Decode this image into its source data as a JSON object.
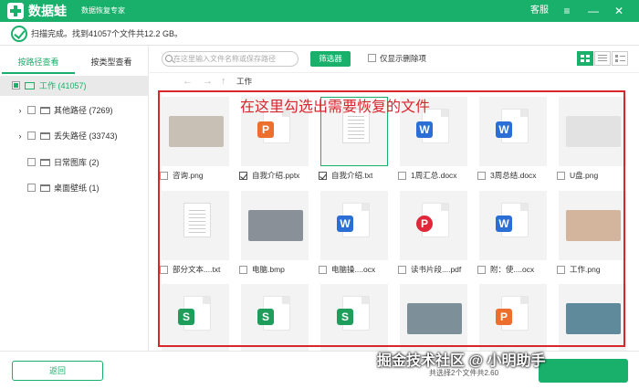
{
  "app": {
    "name": "数据蛙",
    "subtitle": "数据恢复专家",
    "service": "客服"
  },
  "window": {
    "menu_icon": "menu-icon",
    "minimize_icon": "minimize-icon",
    "close_icon": "close-icon"
  },
  "status": {
    "text": "扫描完成。找到41057个文件共12.2 GB。"
  },
  "sidebar": {
    "tabs": [
      {
        "label": "按路径查看",
        "active": true
      },
      {
        "label": "按类型查看",
        "active": false
      }
    ],
    "tree": [
      {
        "label": "工作 (41057)",
        "expandable": false,
        "selected": true,
        "check": "partial",
        "icon": "drive-icon"
      },
      {
        "label": "其他路径 (7269)",
        "expandable": true,
        "selected": false,
        "check": "none",
        "icon": "folder-icon"
      },
      {
        "label": "丢失路径 (33743)",
        "expandable": true,
        "selected": false,
        "check": "none",
        "icon": "folder-icon"
      },
      {
        "label": "日常图库 (2)",
        "expandable": false,
        "selected": false,
        "check": "none",
        "icon": "folder-icon"
      },
      {
        "label": "桌面壁纸 (1)",
        "expandable": false,
        "selected": false,
        "check": "none",
        "icon": "folder-icon"
      }
    ]
  },
  "toolbar": {
    "search_placeholder": "在这里输入文件名称或保存路径",
    "filter_label": "筛选器",
    "deleted_only_label": "仅显示删除项",
    "views": [
      "grid-view-icon",
      "list-view-icon",
      "detail-view-icon"
    ]
  },
  "path": {
    "current": "工作"
  },
  "annotation": {
    "text": "在这里勾选出需要恢复的文件"
  },
  "files": [
    {
      "name": "咨询.png",
      "type": "image",
      "checked": false,
      "color": "#c9c0b5"
    },
    {
      "name": "自我介绍.pptx",
      "type": "ppt",
      "checked": true
    },
    {
      "name": "自我介绍.txt",
      "type": "txt",
      "checked": true,
      "highlight": true
    },
    {
      "name": "1周汇总.docx",
      "type": "word",
      "checked": false
    },
    {
      "name": "3周总结.docx",
      "type": "word",
      "checked": false
    },
    {
      "name": "U盘.png",
      "type": "image",
      "checked": false,
      "color": "#e2e2e2"
    },
    {
      "name": "部分文本....txt",
      "type": "txt",
      "checked": false
    },
    {
      "name": "电脑.bmp",
      "type": "image",
      "checked": false,
      "color": "#8a9097"
    },
    {
      "name": "电脑操....ocx",
      "type": "word",
      "checked": false
    },
    {
      "name": "读书片段....pdf",
      "type": "pdf",
      "checked": false
    },
    {
      "name": "附：使....ocx",
      "type": "word",
      "checked": false
    },
    {
      "name": "工作.png",
      "type": "image",
      "checked": false,
      "color": "#d3b49c"
    },
    {
      "name": "",
      "type": "sheet",
      "checked": false
    },
    {
      "name": "",
      "type": "sheet",
      "checked": false
    },
    {
      "name": "",
      "type": "sheet",
      "checked": false
    },
    {
      "name": "",
      "type": "image",
      "checked": false,
      "color": "#7d8f99"
    },
    {
      "name": "",
      "type": "ppt",
      "checked": false
    },
    {
      "name": "",
      "type": "image",
      "checked": false,
      "color": "#5f8a9c"
    }
  ],
  "bottom": {
    "back_label": "返回"
  },
  "watermark": {
    "text": "掘金技术社区 @ 小明助手",
    "small": "共选择2个文件共2.60"
  },
  "colors": {
    "brand": "#19b06b",
    "annotation": "#d8262e",
    "word": "#2b6fd6",
    "ppt": "#ec6f2d",
    "pdf": "#e0283a",
    "sheet": "#1e9e5a"
  }
}
